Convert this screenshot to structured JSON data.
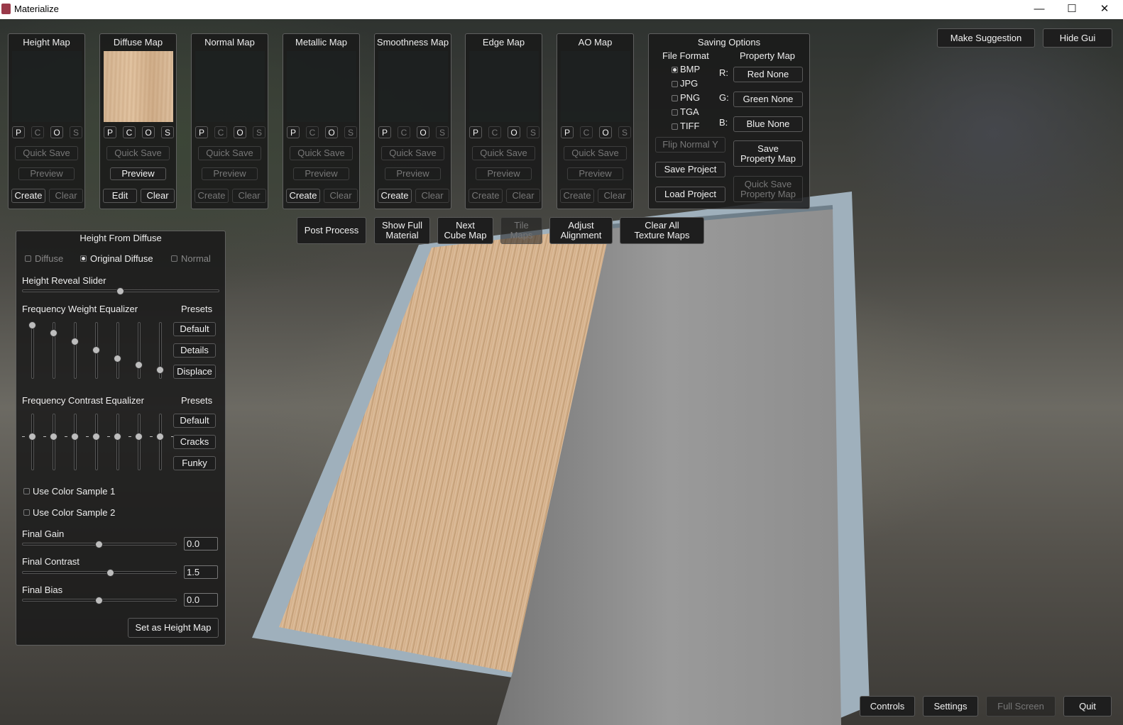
{
  "window": {
    "title": "Materialize",
    "minimize": "—",
    "maximize": "☐",
    "close": "✕"
  },
  "map_panels": [
    {
      "title": "Height Map",
      "quick_save": "Quick Save",
      "preview": "Preview",
      "left": "Create",
      "right": "Clear"
    },
    {
      "title": "Diffuse Map",
      "quick_save": "Quick Save",
      "preview": "Preview",
      "left": "Edit",
      "right": "Clear"
    },
    {
      "title": "Normal Map",
      "quick_save": "Quick Save",
      "preview": "Preview",
      "left": "Create",
      "right": "Clear"
    },
    {
      "title": "Metallic Map",
      "quick_save": "Quick Save",
      "preview": "Preview",
      "left": "Create",
      "right": "Clear"
    },
    {
      "title": "Smoothness Map",
      "quick_save": "Quick Save",
      "preview": "Preview",
      "left": "Create",
      "right": "Clear"
    },
    {
      "title": "Edge Map",
      "quick_save": "Quick Save",
      "preview": "Preview",
      "left": "Create",
      "right": "Clear"
    },
    {
      "title": "AO Map",
      "quick_save": "Quick Save",
      "preview": "Preview",
      "left": "Create",
      "right": "Clear"
    }
  ],
  "pcos": [
    "P",
    "C",
    "O",
    "S"
  ],
  "saving": {
    "title": "Saving Options",
    "file_format_label": "File Format",
    "property_map_label": "Property Map",
    "formats": [
      "BMP",
      "JPG",
      "PNG",
      "TGA",
      "TIFF"
    ],
    "selected_format": "BMP",
    "channels": [
      {
        "label": "R:",
        "value": "Red None"
      },
      {
        "label": "G:",
        "value": "Green None"
      },
      {
        "label": "B:",
        "value": "Blue None"
      }
    ],
    "flip_normal_y": "Flip Normal Y",
    "save_project": "Save Project",
    "load_project": "Load Project",
    "save_property_map_1": "Save",
    "save_property_map_2": "Property Map",
    "quick_save_property_1": "Quick Save",
    "quick_save_property_2": "Property Map"
  },
  "top_right": {
    "suggestion": "Make Suggestion",
    "hide_gui": "Hide Gui"
  },
  "toolbar": {
    "post_process": "Post Process",
    "show_full_1": "Show Full",
    "show_full_2": "Material",
    "next_cube_1": "Next",
    "next_cube_2": "Cube Map",
    "tile_maps_1": "Tile",
    "tile_maps_2": "Maps",
    "adjust_1": "Adjust",
    "adjust_2": "Alignment",
    "clear_all_1": "Clear All",
    "clear_all_2": "Texture Maps"
  },
  "hfd": {
    "title": "Height From Diffuse",
    "sources": [
      "Diffuse",
      "Original Diffuse",
      "Normal"
    ],
    "selected_source": "Original Diffuse",
    "reveal_label": "Height Reveal Slider",
    "reveal_value": 0.5,
    "freq_weight_label": "Frequency Weight Equalizer",
    "freq_weight_values": [
      1.0,
      0.85,
      0.67,
      0.5,
      0.33,
      0.2,
      0.1
    ],
    "presets_label": "Presets",
    "weight_presets": [
      "Default",
      "Details",
      "Displace"
    ],
    "freq_contrast_label": "Frequency Contrast Equalizer",
    "freq_contrast_values": [
      0.6,
      0.6,
      0.6,
      0.6,
      0.6,
      0.6,
      0.6
    ],
    "contrast_presets": [
      "Default",
      "Cracks",
      "Funky"
    ],
    "use_sample_1": "Use Color Sample 1",
    "use_sample_2": "Use Color Sample 2",
    "final_gain_label": "Final Gain",
    "final_gain": "0.0",
    "final_contrast_label": "Final Contrast",
    "final_contrast": "1.5",
    "final_bias_label": "Final Bias",
    "final_bias": "0.0",
    "set_height": "Set as Height Map"
  },
  "bottom": {
    "controls": "Controls",
    "settings": "Settings",
    "full_screen": "Full Screen",
    "quit": "Quit"
  }
}
